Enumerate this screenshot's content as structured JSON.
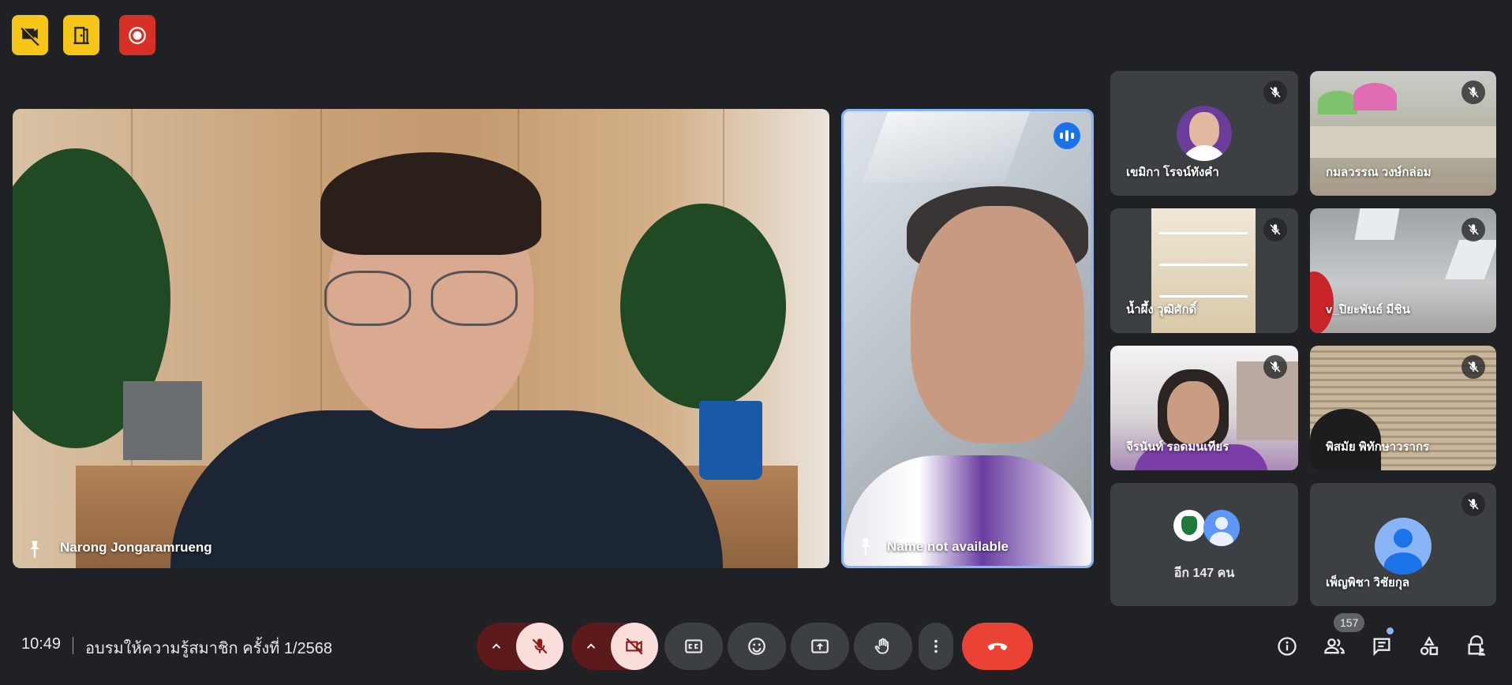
{
  "status_chips": [
    {
      "icon": "no-video-recording-icon",
      "color": "#f5c518"
    },
    {
      "icon": "door-companion-icon",
      "color": "#f5c518"
    },
    {
      "icon": "recording-icon",
      "color": "#d93025"
    }
  ],
  "main_tiles": [
    {
      "name": "Narong Jongaramrueng",
      "pinned": true
    },
    {
      "name": "Name not available",
      "pinned": true,
      "speaking": true
    }
  ],
  "grid_tiles": [
    {
      "name": "เขมิกา โรจน์ทังคำ",
      "muted": true
    },
    {
      "name": "กมลวรรณ วงษ์กล่อม",
      "muted": true
    },
    {
      "name": "น้ำผึ้ง วุฒิศักดิ์",
      "muted": true
    },
    {
      "name": "v_ปิยะพันธ์ มีชิน",
      "muted": true
    },
    {
      "name": "จีรนันท์ รอดมนเทียร",
      "muted": true
    },
    {
      "name": "พิสมัย พิทักษาวรากร",
      "muted": true
    },
    {
      "name": "อีก 147 คน",
      "muted": false
    },
    {
      "name": "เพ็ญพิชา วิชัยกุล",
      "muted": true
    }
  ],
  "bottom_bar": {
    "time": "10:49",
    "meeting_title": "อบรมให้ความรู้สมาชิก ครั้งที่ 1/2568",
    "participant_count": "157",
    "controls": [
      "microphone-off",
      "camera-off",
      "captions",
      "emoji-reactions",
      "present-screen",
      "raise-hand",
      "more-options",
      "leave-call"
    ],
    "right_icons": [
      "meeting-details",
      "people",
      "chat",
      "activities",
      "host-controls"
    ]
  },
  "colors": {
    "background": "#202124",
    "tile": "#3c4043",
    "danger": "#ea4335",
    "accent_blue": "#1a73e8",
    "warning_yellow": "#f5c518",
    "recording_red": "#d93025"
  }
}
